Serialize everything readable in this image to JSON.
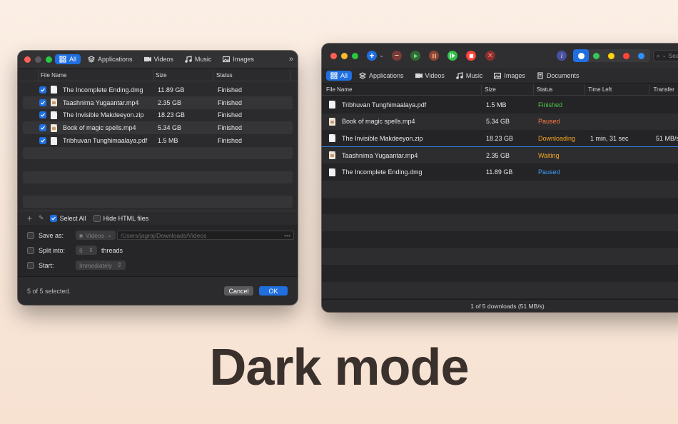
{
  "headline": "Dark mode",
  "colors": {
    "accent": "#1f6fe0",
    "finished": "#4cc94c",
    "paused": "#ff7b45",
    "downloading": "#f5a623",
    "waiting": "#f5a623",
    "paused_blue": "#3aa0ff"
  },
  "left": {
    "categories": [
      {
        "label": "All",
        "icon": "grid-icon",
        "active": true
      },
      {
        "label": "Applications",
        "icon": "layers-icon"
      },
      {
        "label": "Videos",
        "icon": "video-icon"
      },
      {
        "label": "Music",
        "icon": "music-icon"
      },
      {
        "label": "Images",
        "icon": "image-icon"
      }
    ],
    "columns": [
      "File Name",
      "Size",
      "Status"
    ],
    "rows": [
      {
        "name": "The Incomplete Ending.dmg",
        "size": "11.89 GB",
        "status": "Finished"
      },
      {
        "name": "Taashnima Yugaantar.mp4",
        "size": "2.35 GB",
        "status": "Finished"
      },
      {
        "name": "The Invisible Makdeeyon.zip",
        "size": "18.23 GB",
        "status": "Finished"
      },
      {
        "name": "Book of magic spells.mp4",
        "size": "5.34 GB",
        "status": "Finished"
      },
      {
        "name": "Tribhuvan Tunghimaalaya.pdf",
        "size": "1.5 MB",
        "status": "Finished"
      }
    ],
    "select_all": "Select All",
    "hide_html": "Hide HTML files",
    "save_as": "Save as:",
    "save_as_popup": "Videos",
    "save_path": "/Users/jagraj/Downloads/Videos",
    "split_into": "Split into:",
    "threads_value": "8",
    "threads": "threads",
    "start": "Start:",
    "start_popup": "Immediately",
    "selection_status": "5 of 5 selected.",
    "cancel": "Cancel",
    "ok": "OK"
  },
  "right": {
    "categories": [
      {
        "label": "All",
        "icon": "grid-icon",
        "active": true
      },
      {
        "label": "Applications",
        "icon": "layers-icon"
      },
      {
        "label": "Videos",
        "icon": "video-icon"
      },
      {
        "label": "Music",
        "icon": "music-icon"
      },
      {
        "label": "Images",
        "icon": "image-icon"
      },
      {
        "label": "Documents",
        "icon": "documents-icon"
      }
    ],
    "columns": [
      "File Name",
      "Size",
      "Status",
      "Time Left",
      "Transfer"
    ],
    "rows": [
      {
        "name": "Tribhuvan Tunghimaalaya.pdf",
        "size": "1.5 MB",
        "status": "Finished",
        "time_left": "",
        "transfer": "",
        "status_color": "#4cc94c"
      },
      {
        "name": "Book of magic spells.mp4",
        "size": "5.34 GB",
        "status": "Paused",
        "time_left": "",
        "transfer": "",
        "status_color": "#ff7b45"
      },
      {
        "name": "The Invisible Makdeeyon.zip",
        "size": "18.23 GB",
        "status": "Downloading",
        "time_left": "1 min, 31 sec",
        "transfer": "51 MB/s",
        "status_color": "#f5a623"
      },
      {
        "name": "Taashnima Yugaantar.mp4",
        "size": "2.35 GB",
        "status": "Waiting",
        "time_left": "",
        "transfer": "",
        "status_color": "#f5a623"
      },
      {
        "name": "The Incomplete Ending.dmg",
        "size": "11.89 GB",
        "status": "Paused",
        "time_left": "",
        "transfer": "",
        "status_color": "#3aa0ff"
      }
    ],
    "search_placeholder": "Search",
    "status_bar": "1 of 5 downloads (51 MB/s)"
  }
}
